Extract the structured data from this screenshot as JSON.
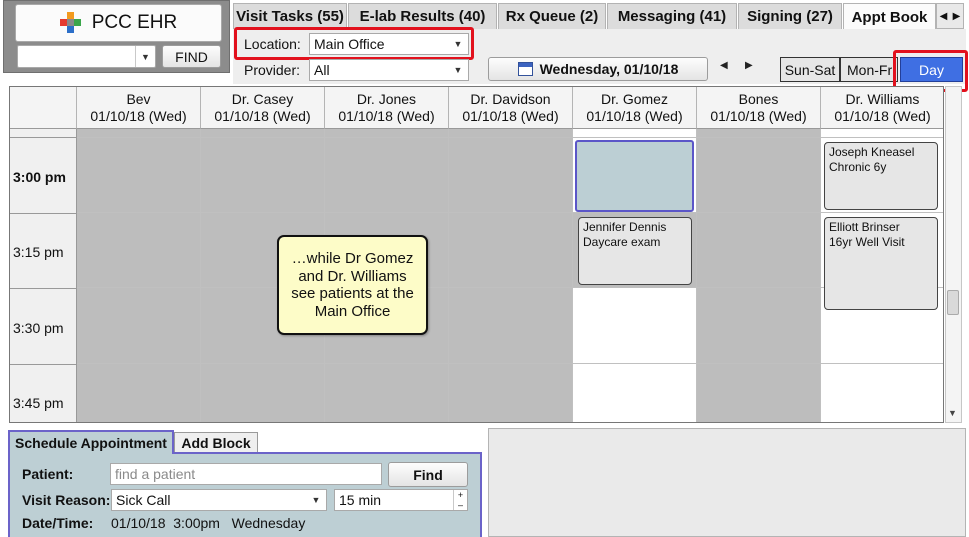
{
  "app": {
    "title": "PCC EHR",
    "find_label": "FIND"
  },
  "tabs": [
    {
      "label": "Visit Tasks (55)"
    },
    {
      "label": "E-lab Results (40)"
    },
    {
      "label": "Rx Queue (2)"
    },
    {
      "label": "Messaging (41)"
    },
    {
      "label": "Signing (27)"
    },
    {
      "label": "Appt Book",
      "active": true
    }
  ],
  "tab_scroll": {
    "left": "◀",
    "right": "▶"
  },
  "filters": {
    "location_label": "Location:",
    "location_value": "Main Office",
    "provider_label": "Provider:",
    "provider_value": "All"
  },
  "date_nav": {
    "date": "Wednesday, 01/10/18",
    "prev": "◀",
    "next": "▶"
  },
  "views": {
    "sun_sat": "Sun-Sat",
    "mon_fri": "Mon-Fri",
    "day": "Day",
    "active": "Day"
  },
  "grid": {
    "providers": [
      {
        "name": "Bev",
        "date": "01/10/18 (Wed)"
      },
      {
        "name": "Dr. Casey",
        "date": "01/10/18 (Wed)"
      },
      {
        "name": "Dr. Jones",
        "date": "01/10/18 (Wed)"
      },
      {
        "name": "Dr. Davidson",
        "date": "01/10/18 (Wed)"
      },
      {
        "name": "Dr. Gomez",
        "date": "01/10/18 (Wed)"
      },
      {
        "name": "Bones",
        "date": "01/10/18 (Wed)"
      },
      {
        "name": "Dr. Williams",
        "date": "01/10/18 (Wed)"
      }
    ],
    "times": [
      "3:00 pm",
      "3:15 pm",
      "3:30 pm",
      "3:45 pm"
    ],
    "appointments": [
      {
        "provider": "Dr. Williams",
        "time": "3:00 pm",
        "patient": "Joseph Kneasel",
        "reason": "Chronic 6y"
      },
      {
        "provider": "Dr. Gomez",
        "time": "3:15 pm",
        "patient": "Jennifer Dennis",
        "reason": "Daycare exam"
      },
      {
        "provider": "Dr. Williams",
        "time": "3:15 pm",
        "patient": "Elliott Brinser",
        "reason": "16yr Well Visit"
      }
    ]
  },
  "callout": {
    "lines": [
      "…while Dr Gomez",
      "and Dr. Williams",
      "see patients at the",
      "Main Office"
    ]
  },
  "schedule": {
    "tab_schedule": "Schedule Appointment",
    "tab_block": "Add Block",
    "patient_label": "Patient:",
    "patient_placeholder": "find a patient",
    "find_button": "Find",
    "visit_reason_label": "Visit Reason:",
    "visit_reason_value": "Sick Call",
    "duration_value": "15 min",
    "datetime_label": "Date/Time:",
    "datetime_value": "01/10/18  3:00pm   Wednesday"
  },
  "colors": {
    "highlight_red": "#e2111d",
    "day_button": "#3f6fe3",
    "callout_bg": "#fdfcc8",
    "unavailable": "#bdbdbd",
    "selected_slot": "#bccfd4"
  }
}
